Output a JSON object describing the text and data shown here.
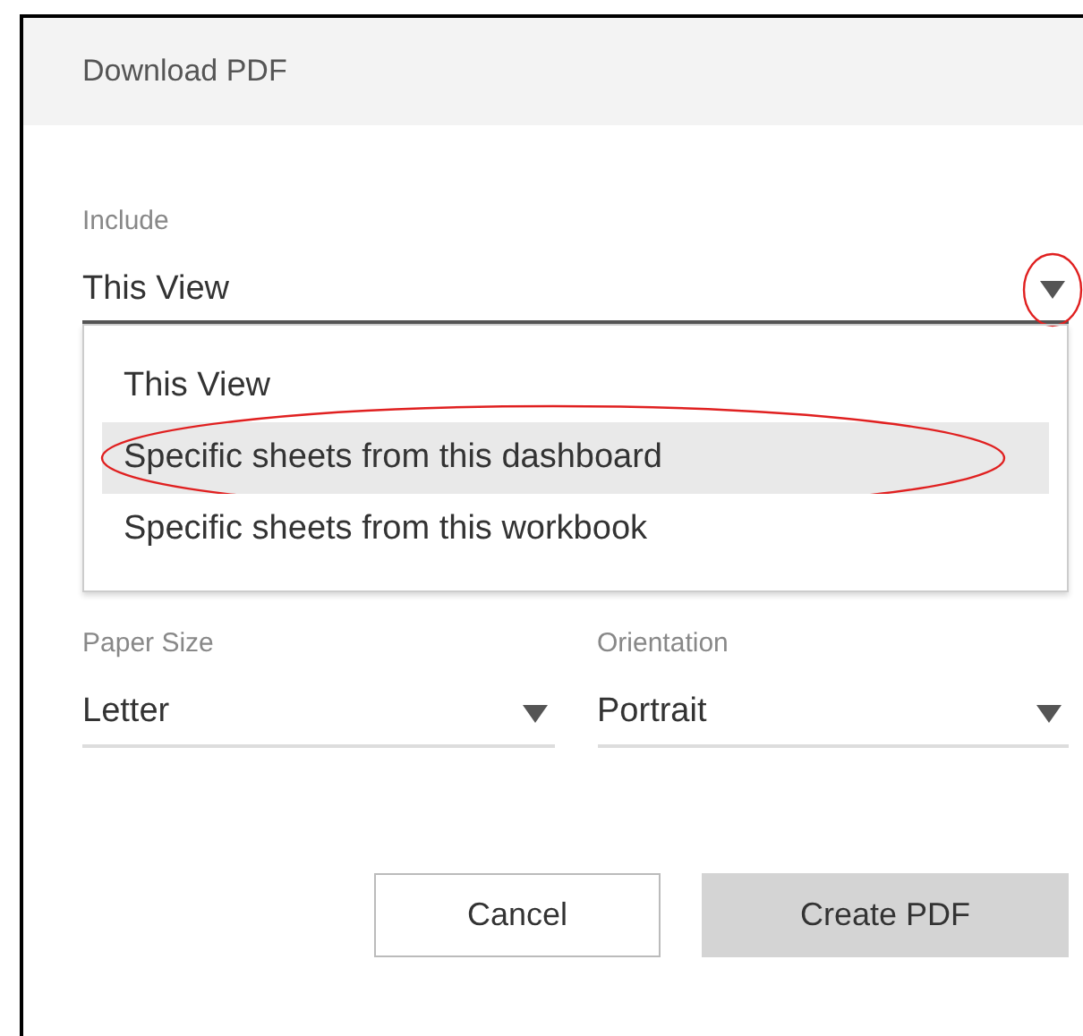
{
  "dialog": {
    "title": "Download PDF"
  },
  "include": {
    "label": "Include",
    "value": "This View",
    "expanded": true,
    "caret_circled": true,
    "options": [
      {
        "label": "This View",
        "highlighted": false,
        "circled": false
      },
      {
        "label": "Specific sheets from this dashboard",
        "highlighted": true,
        "circled": true
      },
      {
        "label": "Specific sheets from this workbook",
        "highlighted": false,
        "circled": false
      }
    ]
  },
  "fields": [
    {
      "label": "Paper Size",
      "value": "Letter"
    },
    {
      "label": "Orientation",
      "value": "Portrait"
    }
  ],
  "buttons": [
    {
      "label": "Cancel",
      "kind": "secondary"
    },
    {
      "label": "Create PDF",
      "kind": "primary"
    }
  ]
}
